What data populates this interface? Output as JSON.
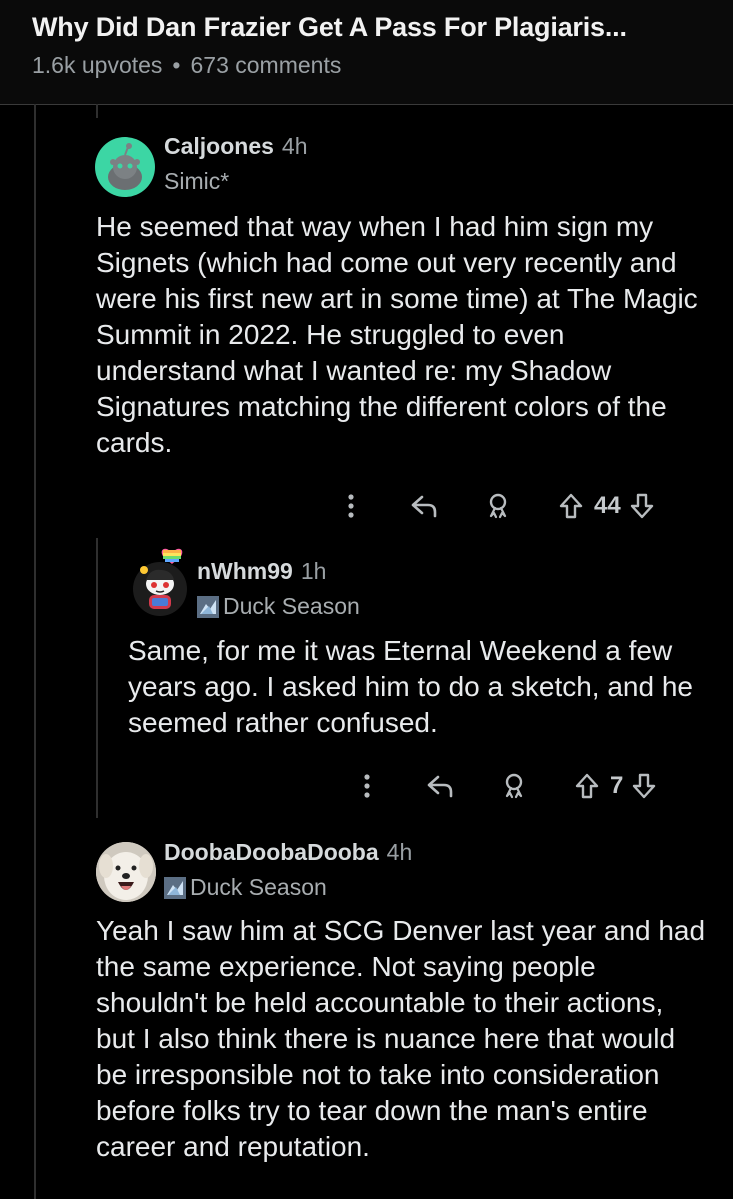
{
  "post": {
    "title": "Why Did Dan Frazier Get A Pass For Plagiaris...",
    "upvotes": "1.6k upvotes",
    "separator": "•",
    "comments": "673 comments"
  },
  "comments": [
    {
      "username": "Caljoones",
      "time": "4h",
      "flair": "Simic*",
      "body": "He seemed that way when I had him sign my Signets (which had come out very recently and were his first new art in some time) at The Magic Summit in 2022. He struggled to even understand what I wanted re: my Shadow Signatures matching the different colors of the cards.",
      "score": "44",
      "avatar_color": "#3cd6a4"
    },
    {
      "username": "nWhm99",
      "time": "1h",
      "flair": "Duck Season",
      "body": "Same, for me it was Eternal Weekend a few years ago. I asked him to do a sketch, and he seemed rather confused.",
      "score": "7"
    },
    {
      "username": "DoobaDoobaDooba",
      "time": "4h",
      "flair": "Duck Season",
      "body": "Yeah I saw him at SCG Denver last year and had the same experience. Not saying people shouldn't be held accountable to their actions, but I also think there is nuance here that would be irresponsible not to take into consideration before folks try to tear down the man's entire career and reputation."
    }
  ],
  "icons": {
    "more": "more-vertical-icon",
    "reply": "reply-icon",
    "award": "award-icon",
    "upvote": "upvote-arrow-icon",
    "downvote": "downvote-arrow-icon",
    "flair": "duck-season-flair-icon"
  }
}
